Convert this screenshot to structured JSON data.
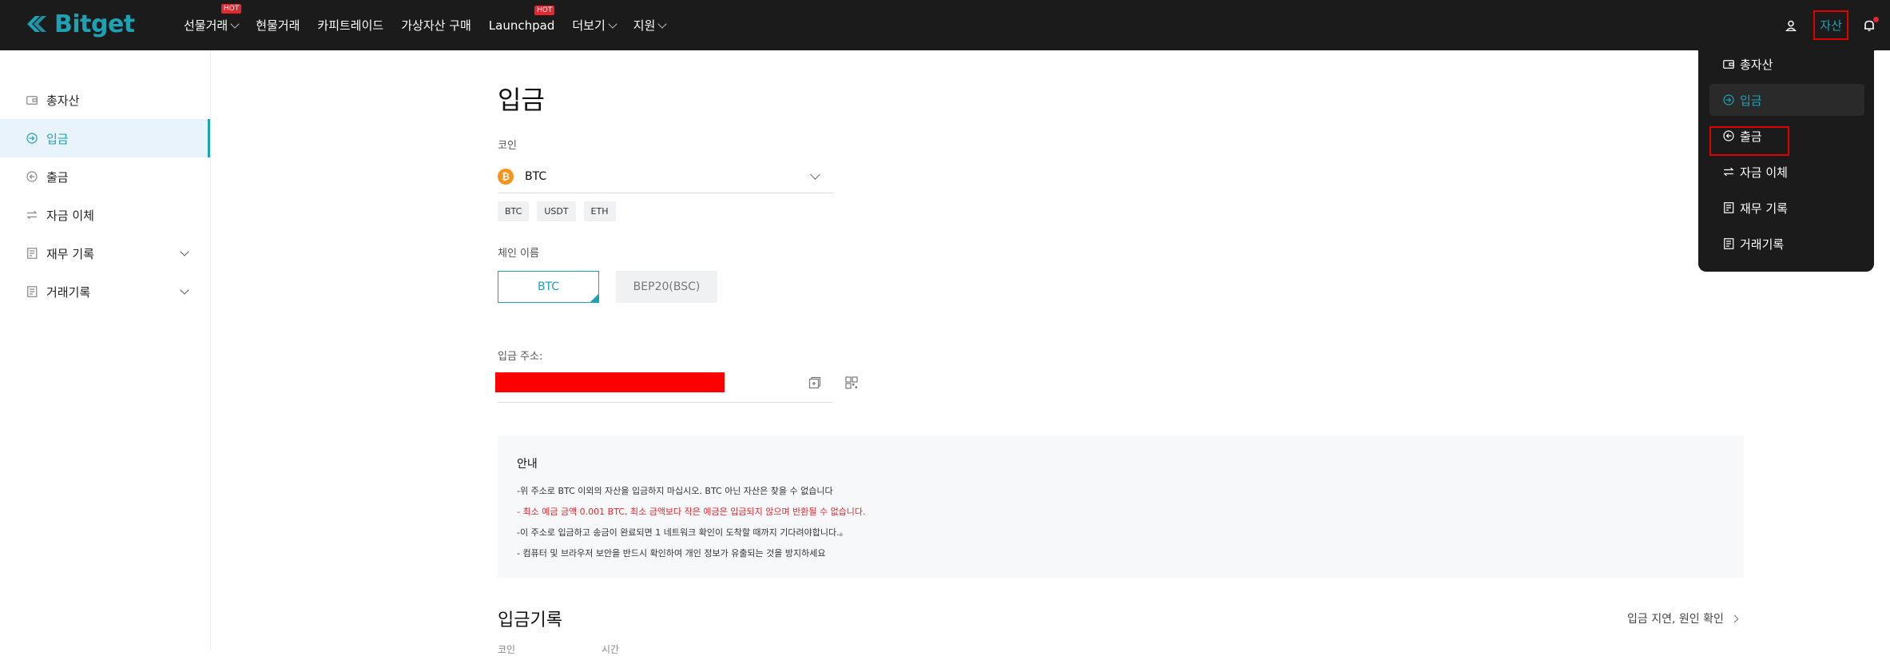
{
  "brand": {
    "name": "Bitget",
    "color": "#1da2b4"
  },
  "nav": {
    "items": [
      {
        "label": "선물거래",
        "hot": "HOT",
        "dropdown": true
      },
      {
        "label": "현물거래",
        "hot": "",
        "dropdown": false
      },
      {
        "label": "카피트레이드",
        "hot": "",
        "dropdown": false
      },
      {
        "label": "가상자산 구매",
        "hot": "",
        "dropdown": false
      },
      {
        "label": "Launchpad",
        "hot": "HOT",
        "dropdown": false
      },
      {
        "label": "더보기",
        "hot": "",
        "dropdown": true
      },
      {
        "label": "지원",
        "hot": "",
        "dropdown": true
      }
    ],
    "asset_label": "자산"
  },
  "sidebar": {
    "items": [
      {
        "label": "총자산",
        "icon": "wallet-icon"
      },
      {
        "label": "입금",
        "icon": "deposit-icon",
        "active": true
      },
      {
        "label": "출금",
        "icon": "withdraw-icon"
      },
      {
        "label": "자금 이체",
        "icon": "transfer-icon"
      },
      {
        "label": "재무 기록",
        "icon": "record-icon",
        "expandable": true
      },
      {
        "label": "거래기록",
        "icon": "trade-record-icon",
        "expandable": true
      }
    ]
  },
  "main": {
    "title": "입금",
    "coin_label": "코인",
    "coin_selected": "BTC",
    "coin_icon_glyph": "₿",
    "coin_chips": [
      "BTC",
      "USDT",
      "ETH"
    ],
    "chain_label": "체인 이름",
    "chains": [
      "BTC",
      "BEP20(BSC)"
    ],
    "address_label": "입금 주소:",
    "notice": {
      "title": "안내",
      "lines": [
        "-위 주소로 BTC 이외의 자산을 입금하지 마십시오. BTC 아닌 자산은 찾을 수 없습니다",
        "- 최소 예금 금액 0.001 BTC, 최소 금액보다 작은 예금은 입금되지 않으며 반환될 수 없습니다.",
        "-이 주소로 입금하고 송금이 완료되면 1 네트워크 확인이 도착할 때까지 기다려야합니다.。",
        "- 컴퓨터 및 브라우저 보안을 반드시 확인하여 개인 정보가 유출되는 것을 방지하세요"
      ]
    },
    "records_title": "입금기록",
    "records_link": "입금 지연, 원인 확인",
    "columns": [
      "코인",
      "시간"
    ]
  },
  "dropdown": {
    "items": [
      {
        "label": "총자산",
        "icon": "wallet-icon"
      },
      {
        "label": "입금",
        "icon": "deposit-icon",
        "active": true
      },
      {
        "label": "출금",
        "icon": "withdraw-icon"
      },
      {
        "label": "자금 이체",
        "icon": "transfer-icon"
      },
      {
        "label": "재무 기록",
        "icon": "record-icon"
      },
      {
        "label": "거래기록",
        "icon": "trade-record-icon"
      }
    ]
  }
}
